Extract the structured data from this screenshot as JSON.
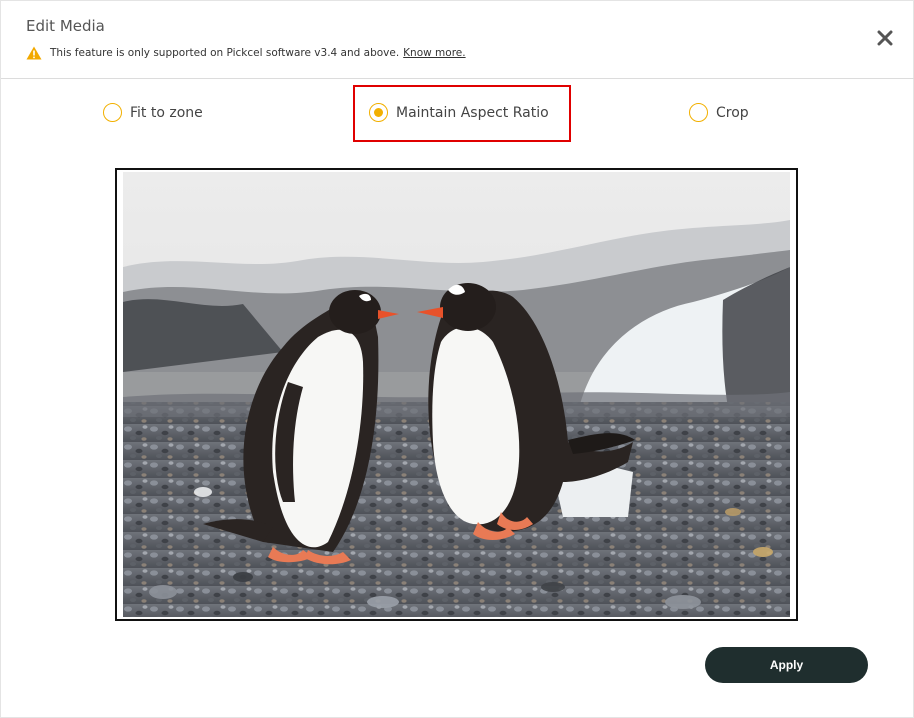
{
  "dialog": {
    "title": "Edit Media",
    "notice_text": "This feature is only supported on Pickcel software v3.4 and above.",
    "notice_link": "Know more.",
    "close_icon": "close-icon",
    "warning_icon": "warning-icon"
  },
  "options": [
    {
      "label": "Fit to zone",
      "selected": false
    },
    {
      "label": "Maintain Aspect Ratio",
      "selected": true
    },
    {
      "label": "Crop",
      "selected": false
    }
  ],
  "colors": {
    "accent_radio": "#f2b000",
    "highlight_box": "#e00000",
    "apply_button": "#1f2e2e"
  },
  "footer": {
    "apply_label": "Apply"
  }
}
